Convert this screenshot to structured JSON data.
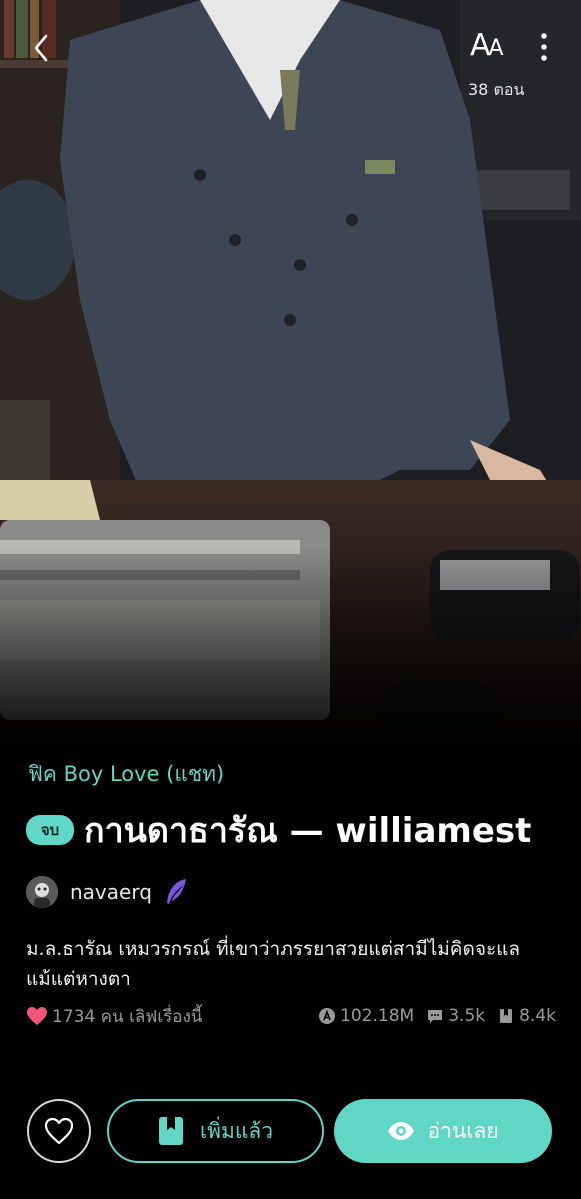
{
  "header": {
    "font_size_label_big": "A",
    "font_size_label_small": "A",
    "episodes": "38 ตอน"
  },
  "cover": {
    "description_icon": "cover-photo"
  },
  "story": {
    "category": "ฟิค Boy Love (แชท)",
    "status_badge": "จบ",
    "title": "กานดาธารัณ — williamest",
    "author": "navaerq",
    "synopsis": "ม.ล.ธารัณ เหมวรกรณ์ ที่เขาว่าภรรยาสวยแต่สามีไม่คิดจะแลแม้แต่หางตา"
  },
  "stats": {
    "likes": "1734 คน เลิฟเรื่องนี้",
    "views": "102.18M",
    "comments": "3.5k",
    "library": "8.4k"
  },
  "actions": {
    "library_label": "เพิ่มแล้ว",
    "read_label": "อ่านเลย"
  },
  "colors": {
    "accent": "#5fd6c6",
    "heart": "#f2557a",
    "background": "#000000"
  }
}
